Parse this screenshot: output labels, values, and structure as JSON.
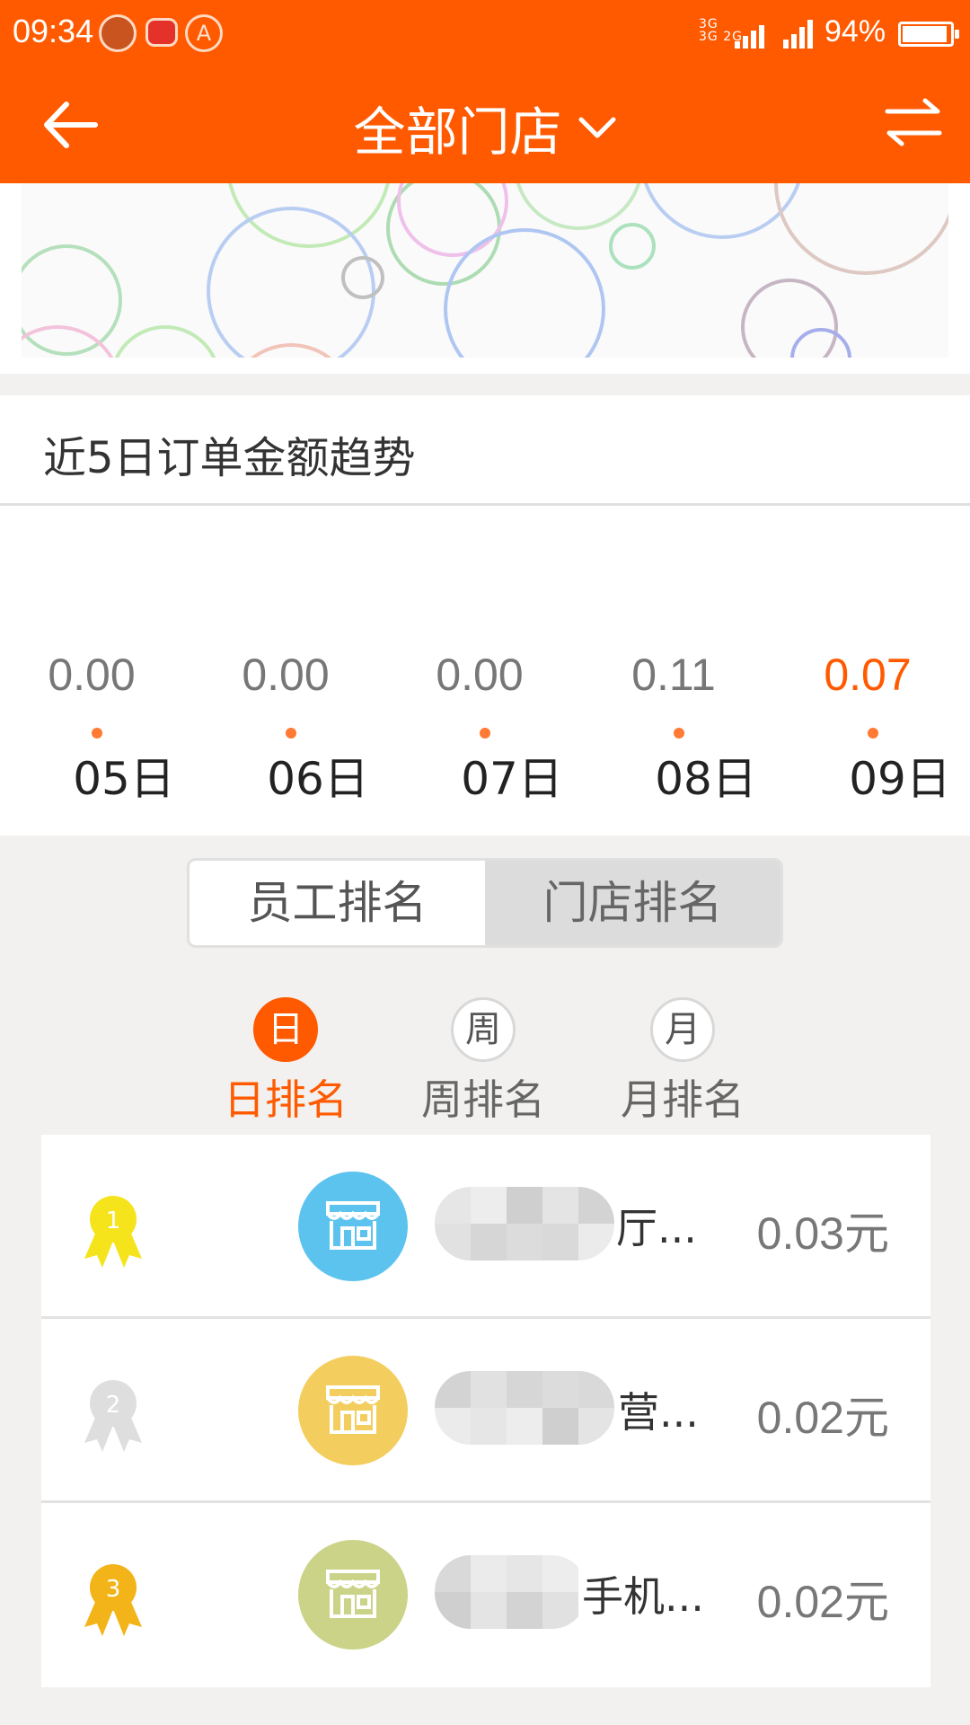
{
  "status_bar": {
    "time": "09:34",
    "network_labels": [
      "3G",
      "3G",
      "2G"
    ],
    "battery_percent": "94%",
    "battery_level": 0.94
  },
  "header": {
    "title": "全部门店",
    "back_icon": "back-arrow-icon",
    "dropdown_icon": "chevron-down-icon",
    "swap_icon": "swap-arrows-icon"
  },
  "trend": {
    "title": "近5日订单金额趋势",
    "chart_data": {
      "type": "line",
      "categories": [
        "05日",
        "06日",
        "07日",
        "08日",
        "09日"
      ],
      "values": [
        0.0,
        0.0,
        0.0,
        0.11,
        0.07
      ],
      "value_labels": [
        "0.00",
        "0.00",
        "0.00",
        "0.11",
        "0.07"
      ],
      "highlight_index": 4,
      "line_color": "#ff7a33",
      "label_color": "#777777",
      "highlight_color": "#ff5a00"
    }
  },
  "ranking_tabs": {
    "employee": "员工排名",
    "store": "门店排名"
  },
  "period_tabs": [
    {
      "icon_char": "日",
      "label": "日排名",
      "active": true
    },
    {
      "icon_char": "周",
      "label": "周排名",
      "active": false
    },
    {
      "icon_char": "月",
      "label": "月排名",
      "active": false
    }
  ],
  "rankings": [
    {
      "rank": "1",
      "medal_color": "#f5e31c",
      "avatar_color": "#5cc3ef",
      "name_suffix": "厅...",
      "amount": "0.03元"
    },
    {
      "rank": "2",
      "medal_color": "#dedede",
      "avatar_color": "#f3ce5e",
      "name_suffix": "营...",
      "amount": "0.02元"
    },
    {
      "rank": "3",
      "medal_color": "#f2b418",
      "avatar_color": "#cbd388",
      "name_suffix": "手机...",
      "amount": "0.02元"
    }
  ],
  "colors": {
    "brand": "#ff5a00"
  }
}
